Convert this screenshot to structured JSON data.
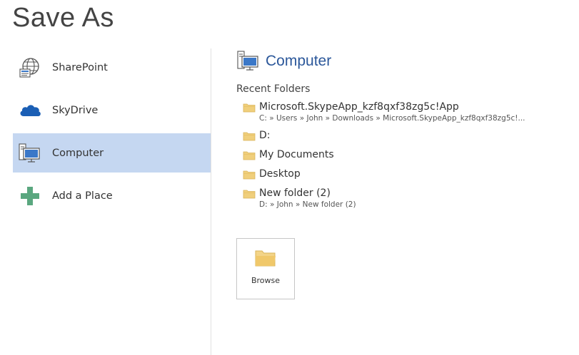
{
  "title": "Save As",
  "places": [
    {
      "label": "SharePoint",
      "icon": "sharepoint-globe-icon",
      "selected": false
    },
    {
      "label": "SkyDrive",
      "icon": "skydrive-cloud-icon",
      "selected": false
    },
    {
      "label": "Computer",
      "icon": "computer-icon",
      "selected": true
    },
    {
      "label": "Add a Place",
      "icon": "plus-icon",
      "selected": false
    }
  ],
  "right_panel": {
    "title": "Computer",
    "icon": "computer-icon",
    "recent_label": "Recent Folders",
    "folders": [
      {
        "name": "Microsoft.SkypeApp_kzf8qxf38zg5c!App",
        "path": "C: » Users » John  » Downloads » Microsoft.SkypeApp_kzf8qxf38zg5c!..."
      },
      {
        "name": "D:",
        "path": ""
      },
      {
        "name": "My Documents",
        "path": ""
      },
      {
        "name": "Desktop",
        "path": ""
      },
      {
        "name": "New folder (2)",
        "path": "D: » John » New folder (2)"
      }
    ],
    "browse_label": "Browse"
  },
  "colors": {
    "selected_bg": "#c5d7f1",
    "accent_blue": "#2b579a",
    "folder_yellow": "#f0cf7c",
    "plus_green": "#5aa77f",
    "cloud_blue": "#1b5fb5"
  }
}
